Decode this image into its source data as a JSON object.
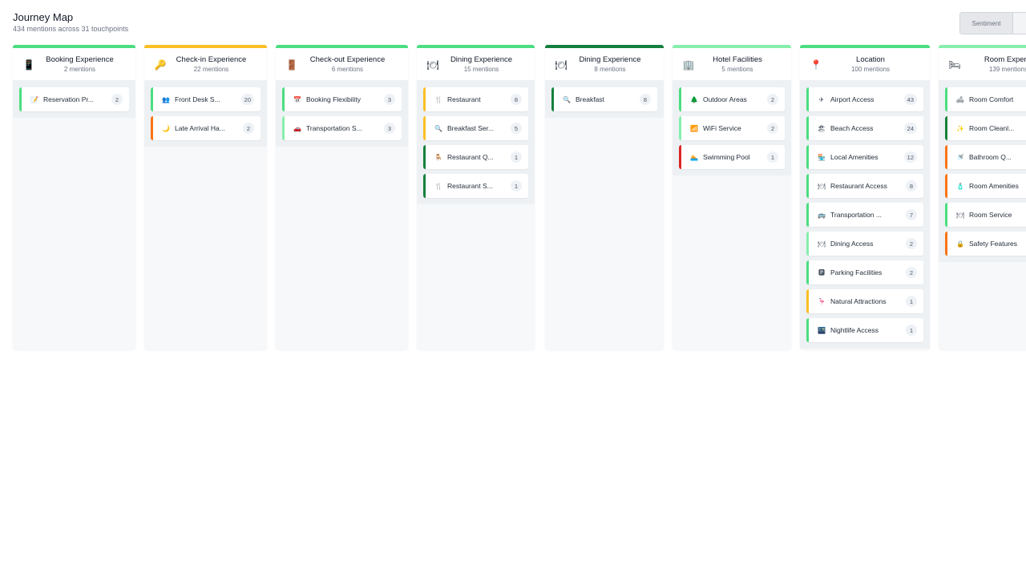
{
  "header": {
    "title": "Journey Map",
    "subtitle": "434 mentions across 31 touchpoints"
  },
  "toggle": {
    "sentiment_label": "Sentiment",
    "second_label": ""
  },
  "colors": {
    "positive": "#4ade80",
    "very_positive": "#15803d",
    "light_positive": "#86efac",
    "neutral": "#fbbf24",
    "negative": "#f97316",
    "very_negative": "#dc2626"
  },
  "columns": [
    {
      "title": "Booking Experience",
      "count": "2 mentions",
      "icon": "📱",
      "icon_name": "phone-icon",
      "bar": "#4ade80",
      "cards": [
        {
          "label": "Reservation Pr...",
          "count": "2",
          "icon": "📝",
          "icon_name": "memo-icon",
          "color": "#4ade80"
        }
      ]
    },
    {
      "title": "Check-in Experience",
      "count": "22 mentions",
      "icon": "🔑",
      "icon_name": "key-icon",
      "bar": "#fbbf24",
      "cards": [
        {
          "label": "Front Desk S...",
          "count": "20",
          "icon": "👥",
          "icon_name": "people-icon",
          "color": "#4ade80"
        },
        {
          "label": "Late Arrival Ha...",
          "count": "2",
          "icon": "🌙",
          "icon_name": "moon-icon",
          "color": "#f97316"
        }
      ]
    },
    {
      "title": "Check-out Experience",
      "count": "6 mentions",
      "icon": "🚪",
      "icon_name": "door-icon",
      "bar": "#4ade80",
      "cards": [
        {
          "label": "Booking Flexibility",
          "count": "3",
          "icon": "📅",
          "icon_name": "calendar-icon",
          "color": "#4ade80"
        },
        {
          "label": "Transportation S...",
          "count": "3",
          "icon": "🚗",
          "icon_name": "car-icon",
          "color": "#86efac"
        }
      ]
    },
    {
      "title": "Dining Experience",
      "count": "15 mentions",
      "icon": "🍽",
      "icon_name": "plate-icon",
      "bar": "#4ade80",
      "cards": [
        {
          "label": "Restaurant",
          "count": "8",
          "icon": "🍴",
          "icon_name": "fork-knife-icon",
          "color": "#fbbf24"
        },
        {
          "label": "Breakfast Ser...",
          "count": "5",
          "icon": "🔍",
          "icon_name": "magnifier-icon",
          "color": "#fbbf24"
        },
        {
          "label": "Restaurant Q...",
          "count": "1",
          "icon": "🪑",
          "icon_name": "chair-icon",
          "color": "#15803d"
        },
        {
          "label": "Restaurant S...",
          "count": "1",
          "icon": "🍴",
          "icon_name": "fork-knife-icon",
          "color": "#15803d"
        }
      ]
    },
    {
      "title": "Dining Experience",
      "count": "8 mentions",
      "icon": "🍽",
      "icon_name": "plate-icon",
      "bar": "#15803d",
      "cards": [
        {
          "label": "Breakfast",
          "count": "8",
          "icon": "🔍",
          "icon_name": "magnifier-icon",
          "color": "#15803d"
        }
      ]
    },
    {
      "title": "Hotel Facilities",
      "count": "5 mentions",
      "icon": "🏢",
      "icon_name": "building-icon",
      "bar": "#86efac",
      "cards": [
        {
          "label": "Outdoor Areas",
          "count": "2",
          "icon": "🌲",
          "icon_name": "tree-icon",
          "color": "#4ade80"
        },
        {
          "label": "WiFi Service",
          "count": "2",
          "icon": "📶",
          "icon_name": "wifi-icon",
          "color": "#86efac"
        },
        {
          "label": "Swimming Pool",
          "count": "1",
          "icon": "🏊",
          "icon_name": "swimmer-icon",
          "color": "#dc2626"
        }
      ]
    },
    {
      "title": "Location",
      "count": "100 mentions",
      "icon": "📍",
      "icon_name": "pin-icon",
      "bar": "#4ade80",
      "cards": [
        {
          "label": "Airport Access",
          "count": "43",
          "icon": "✈",
          "icon_name": "airplane-icon",
          "color": "#4ade80"
        },
        {
          "label": "Beach Access",
          "count": "24",
          "icon": "🏖",
          "icon_name": "beach-icon",
          "color": "#4ade80"
        },
        {
          "label": "Local Amenities",
          "count": "12",
          "icon": "🏪",
          "icon_name": "store-icon",
          "color": "#4ade80"
        },
        {
          "label": "Restaurant Access",
          "count": "8",
          "icon": "🍽",
          "icon_name": "plate-icon",
          "color": "#4ade80"
        },
        {
          "label": "Transportation ...",
          "count": "7",
          "icon": "🚌",
          "icon_name": "bus-icon",
          "color": "#4ade80"
        },
        {
          "label": "Dining Access",
          "count": "2",
          "icon": "🍽",
          "icon_name": "plate-icon",
          "color": "#86efac"
        },
        {
          "label": "Parking Facilities",
          "count": "2",
          "icon": "🅿",
          "icon_name": "parking-icon",
          "color": "#4ade80"
        },
        {
          "label": "Natural Attractions",
          "count": "1",
          "icon": "🦩",
          "icon_name": "flamingo-icon",
          "color": "#fbbf24"
        },
        {
          "label": "Nightlife Access",
          "count": "1",
          "icon": "🌃",
          "icon_name": "night-city-icon",
          "color": "#4ade80"
        }
      ]
    },
    {
      "title": "Room Experie",
      "count": "139 mentions",
      "icon": "🛏",
      "icon_name": "bed-icon",
      "bar": "#86efac",
      "cards": [
        {
          "label": "Room Comfort",
          "count": "",
          "icon": "🛋",
          "icon_name": "couch-icon",
          "color": "#4ade80"
        },
        {
          "label": "Room Cleanl...",
          "count": "",
          "icon": "✨",
          "icon_name": "sparkles-icon",
          "color": "#15803d"
        },
        {
          "label": "Bathroom Q...",
          "count": "",
          "icon": "🚿",
          "icon_name": "shower-icon",
          "color": "#f97316"
        },
        {
          "label": "Room Amenities",
          "count": "",
          "icon": "🧴",
          "icon_name": "lotion-icon",
          "color": "#f97316"
        },
        {
          "label": "Room Service",
          "count": "",
          "icon": "🍽",
          "icon_name": "plate-icon",
          "color": "#4ade80"
        },
        {
          "label": "Safety Features",
          "count": "",
          "icon": "🔒",
          "icon_name": "lock-icon",
          "color": "#f97316"
        }
      ]
    }
  ]
}
